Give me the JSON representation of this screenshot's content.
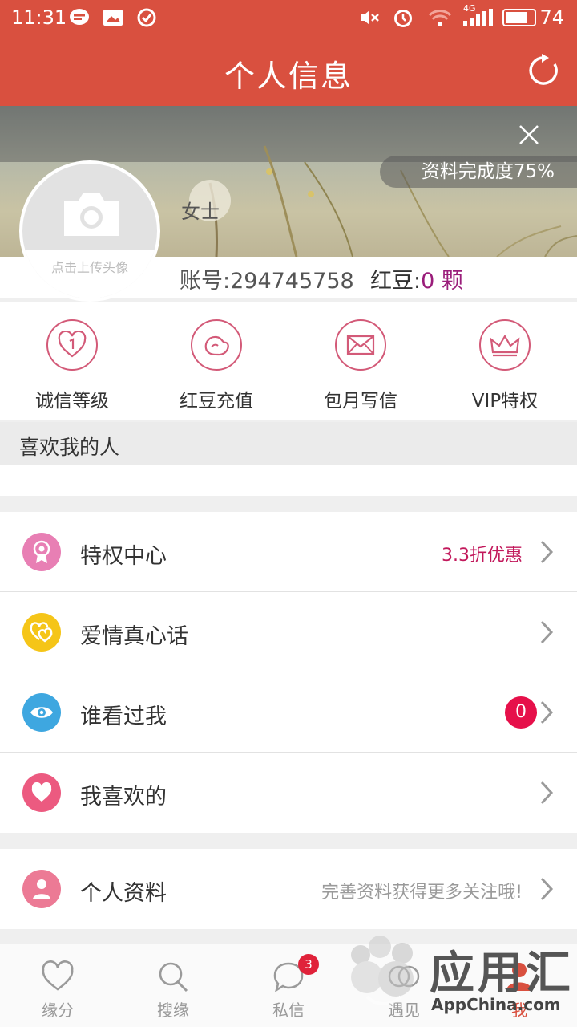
{
  "status_bar": {
    "time": "11:31",
    "signal_tag": "4G",
    "battery": "74"
  },
  "header": {
    "title": "个人信息"
  },
  "banner": {
    "completion": "资料完成度75%",
    "gender": "女士"
  },
  "avatar": {
    "caption": "点击上传头像"
  },
  "account": {
    "id_text": "账号:294745758",
    "beans_label": "红豆:",
    "beans_count": "0",
    "beans_unit": " 颗"
  },
  "quick_actions": [
    {
      "label": "诚信等级",
      "icon": "heart-shield-icon"
    },
    {
      "label": "红豆充值",
      "icon": "bean-icon"
    },
    {
      "label": "包月写信",
      "icon": "envelope-icon"
    },
    {
      "label": "VIP特权",
      "icon": "crown-icon"
    }
  ],
  "likes_section": {
    "title": "喜欢我的人"
  },
  "menu_group1": [
    {
      "label": "特权中心",
      "extra": "3.3折优惠",
      "icon": "medal-icon",
      "color": "#e87fb4"
    },
    {
      "label": "爱情真心话",
      "extra": "",
      "icon": "hearts-icon",
      "color": "#f5c518"
    },
    {
      "label": "谁看过我",
      "badge": "0",
      "icon": "eye-icon",
      "color": "#3ea7e0"
    },
    {
      "label": "我喜欢的",
      "extra": "",
      "icon": "heart-icon",
      "color": "#ec5a80"
    }
  ],
  "menu_group2": [
    {
      "label": "个人资料",
      "extra": "完善资料获得更多关注哦!",
      "icon": "person-icon",
      "color": "#ec7a95"
    }
  ],
  "tabs": [
    {
      "label": "缘分",
      "icon": "heart-outline-icon"
    },
    {
      "label": "搜缘",
      "icon": "search-icon"
    },
    {
      "label": "私信",
      "icon": "chat-icon",
      "badge": "3"
    },
    {
      "label": "遇见",
      "icon": "meet-icon"
    },
    {
      "label": "我",
      "icon": "me-icon",
      "active": true
    }
  ],
  "watermark": {
    "text": "应用汇",
    "sub": "AppChina.com"
  },
  "colors": {
    "primary": "#d9503f",
    "accent": "#d35a78",
    "bean_count": "#9a1d7a",
    "promo": "#c2185b"
  }
}
